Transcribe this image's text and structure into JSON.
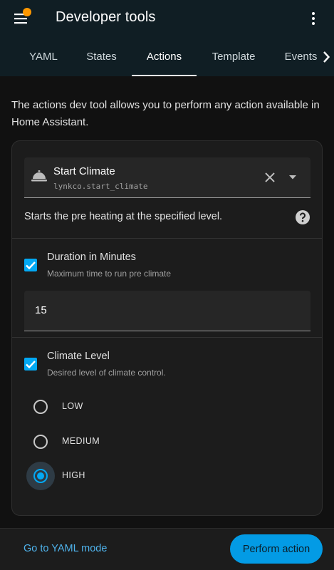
{
  "header": {
    "title": "Developer tools",
    "menu_icon": "hamburger-menu-icon",
    "notification_color": "#ff9800",
    "more_icon": "vertical-dots-icon"
  },
  "tabs": [
    {
      "label": "YAML",
      "active": false
    },
    {
      "label": "States",
      "active": false
    },
    {
      "label": "Actions",
      "active": true
    },
    {
      "label": "Template",
      "active": false
    },
    {
      "label": "Events",
      "active": false
    }
  ],
  "intro": "The actions dev tool allows you to perform any action available in Home Assistant.",
  "action": {
    "name": "Start Climate",
    "id": "lynkco.start_climate",
    "description": "Starts the pre heating at the specified level.",
    "icon": "room-service-bell-icon"
  },
  "fields": {
    "duration": {
      "title": "Duration in Minutes",
      "subtitle": "Maximum time to run pre climate",
      "checked": true,
      "value": "15"
    },
    "climate_level": {
      "title": "Climate Level",
      "subtitle": "Desired level of climate control.",
      "checked": true,
      "options": [
        {
          "label": "LOW",
          "selected": false
        },
        {
          "label": "MEDIUM",
          "selected": false
        },
        {
          "label": "HIGH",
          "selected": true
        }
      ]
    }
  },
  "footer": {
    "yaml_mode": "Go to YAML mode",
    "perform": "Perform action"
  },
  "colors": {
    "accent": "#03a9f4",
    "header_bg": "#101e24",
    "link": "#4fb3ec"
  }
}
